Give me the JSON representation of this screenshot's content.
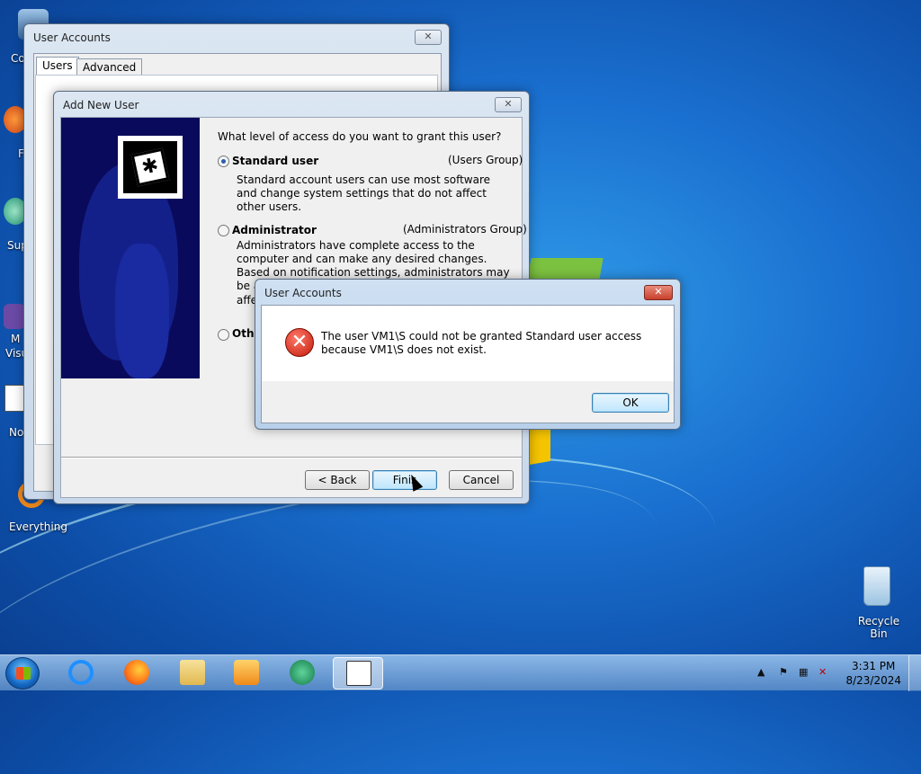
{
  "desktop": {
    "icons": [
      {
        "label": "Co",
        "name": "computer-icon"
      },
      {
        "label": "F",
        "name": "firefox-desktop-icon"
      },
      {
        "label": "Sup",
        "name": "support-icon"
      },
      {
        "label": "M\nVisu",
        "name": "visual-studio-icon"
      },
      {
        "label": "No",
        "name": "notepad-icon"
      },
      {
        "label": "Everything",
        "name": "everything-icon"
      },
      {
        "label": "Recycle Bin",
        "name": "recycle-bin-icon"
      }
    ]
  },
  "user_accounts_window": {
    "title": "User Accounts",
    "close_label": "✕",
    "tabs": [
      "Users",
      "Advanced"
    ]
  },
  "add_user_wizard": {
    "title": "Add New User",
    "close_label": "✕",
    "question": "What level of access do you want to grant this user?",
    "options": [
      {
        "label": "Standard user",
        "group": "(Users Group)",
        "desc": "Standard account users can use most software and change system settings that do not affect other users.",
        "checked": true
      },
      {
        "label": "Administrator",
        "group": "(Administrators Group)",
        "desc": "Administrators have complete access to the computer and can make any desired changes. Based on notification settings, administrators may be asked to provide their pas",
        "desc_tail": "affe",
        "checked": false
      },
      {
        "label": "Othe",
        "group": "",
        "desc": "",
        "checked": false
      }
    ],
    "buttons": {
      "back": "< Back",
      "finish": "Finis",
      "cancel": "Cancel"
    }
  },
  "error_dialog": {
    "title": "User Accounts",
    "close_label": "✕",
    "message": "The user VM1\\S could not be granted Standard user access because VM1\\S does not exist.",
    "ok": "OK"
  },
  "taskbar": {
    "time": "3:31 PM",
    "date": "8/23/2024",
    "apps": [
      "internet-explorer",
      "firefox",
      "file-explorer",
      "media-player",
      "app-green",
      "user-accounts"
    ]
  }
}
